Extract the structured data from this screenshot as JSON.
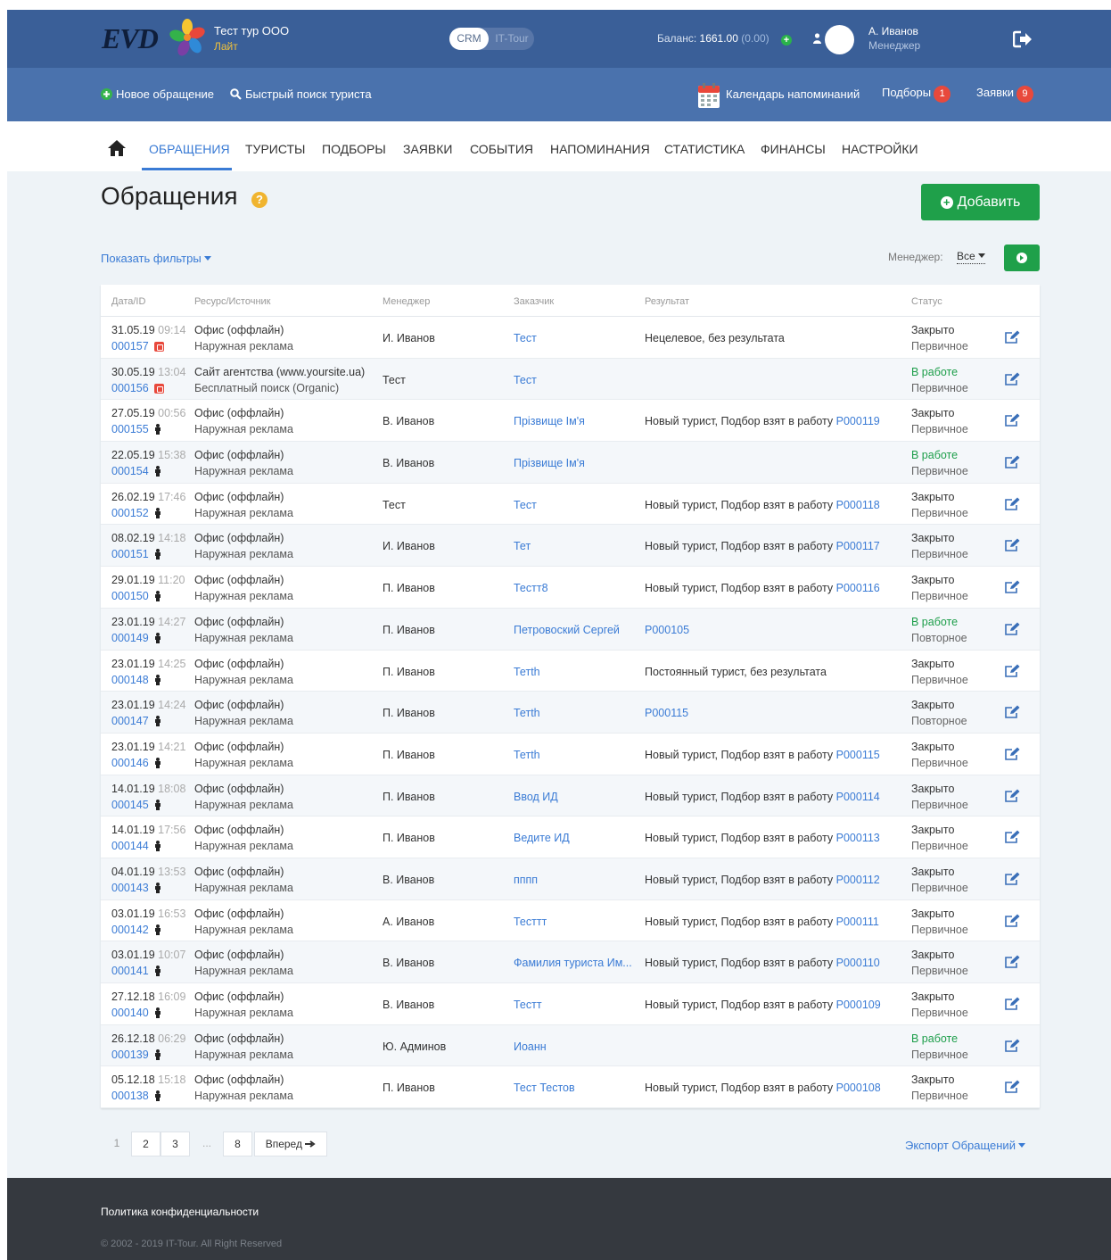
{
  "header": {
    "logo_text": "EVD",
    "company_name": "Тест тур ООО",
    "plan": "Лайт",
    "switch_on": "CRM",
    "switch_off": "IT-Tour",
    "balance_label": "Баланс:",
    "balance_value": "1661.00",
    "balance_extra": "(0.00)",
    "user_name": "А. Иванов",
    "user_role": "Менеджер"
  },
  "subbar": {
    "new_request": "Новое обращение",
    "quick_search": "Быстрый поиск туриста",
    "calendar": "Календарь напоминаний",
    "selections": "Подборы",
    "selections_count": "1",
    "orders": "Заявки",
    "orders_count": "9"
  },
  "nav": {
    "items": [
      "ОБРАЩЕНИЯ",
      "ТУРИСТЫ",
      "ПОДБОРЫ",
      "ЗАЯВКИ",
      "СОБЫТИЯ",
      "НАПОМИНАНИЯ",
      "СТАТИСТИКА",
      "ФИНАНСЫ",
      "НАСТРОЙКИ"
    ]
  },
  "page": {
    "title": "Обращения",
    "help": "?",
    "add_button": "Добавить",
    "show_filters": "Показать фильтры",
    "manager_label": "Менеджер:",
    "manager_value": "Все"
  },
  "table": {
    "headers": [
      "Дата/ID",
      "Ресурс/Источник",
      "Менеджер",
      "Заказчик",
      "Результат",
      "Статус"
    ],
    "rows": [
      {
        "date": "31.05.19",
        "time": "09:14",
        "id": "000157",
        "src": "phone",
        "res1": "Офис (оффлайн)",
        "res2": "Наружная реклама",
        "mgr": "И. Иванов",
        "cust": "Тест",
        "result": "Нецелевое, без результата",
        "rlink": "",
        "st1": "Закрыто",
        "st2": "Первичное"
      },
      {
        "date": "30.05.19",
        "time": "13:04",
        "id": "000156",
        "src": "phone",
        "res1": "Сайт агентства (www.yoursite.ua)",
        "res2": "Бесплатный поиск (Organic)",
        "mgr": "Тест",
        "cust": "Тест",
        "result": "",
        "rlink": "",
        "st1": "",
        "st2": "Первичное"
      },
      {
        "date": "27.05.19",
        "time": "00:56",
        "id": "000155",
        "src": "person",
        "res1": "Офис (оффлайн)",
        "res2": "Наружная реклама",
        "mgr": "В. Иванов",
        "cust": "Прізвище Ім'я",
        "result": "Новый турист, Подбор взят в работу ",
        "rlink": "P000119",
        "st1": "Закрыто",
        "st2": "Первичное"
      },
      {
        "date": "22.05.19",
        "time": "15:38",
        "id": "000154",
        "src": "person",
        "res1": "Офис (оффлайн)",
        "res2": "Наружная реклама",
        "mgr": "В. Иванов",
        "cust": "Прізвище Ім'я",
        "result": "",
        "rlink": "",
        "st1": "",
        "st2": "Первичное"
      },
      {
        "date": "26.02.19",
        "time": "17:46",
        "id": "000152",
        "src": "person",
        "res1": "Офис (оффлайн)",
        "res2": "Наружная реклама",
        "mgr": "Тест",
        "cust": "Тест",
        "result": "Новый турист, Подбор взят в работу ",
        "rlink": "P000118",
        "st1": "Закрыто",
        "st2": "Первичное"
      },
      {
        "date": "08.02.19",
        "time": "14:18",
        "id": "000151",
        "src": "person",
        "res1": "Офис (оффлайн)",
        "res2": "Наружная реклама",
        "mgr": "И. Иванов",
        "cust": "Тет",
        "result": "Новый турист, Подбор взят в работу ",
        "rlink": "P000117",
        "st1": "Закрыто",
        "st2": "Первичное"
      },
      {
        "date": "29.01.19",
        "time": "11:20",
        "id": "000150",
        "src": "person",
        "res1": "Офис (оффлайн)",
        "res2": "Наружная реклама",
        "mgr": "П. Иванов",
        "cust": "Тестт8",
        "result": "Новый турист, Подбор взят в работу ",
        "rlink": "P000116",
        "st1": "Закрыто",
        "st2": "Первичное"
      },
      {
        "date": "23.01.19",
        "time": "14:27",
        "id": "000149",
        "src": "person",
        "res1": "Офис (оффлайн)",
        "res2": "Наружная реклама",
        "mgr": "П. Иванов",
        "cust": "Петровоский Сергей",
        "result": "",
        "rlink": "P000105",
        "st1": "",
        "st2": "Повторное"
      },
      {
        "date": "23.01.19",
        "time": "14:25",
        "id": "000148",
        "src": "person",
        "res1": "Офис (оффлайн)",
        "res2": "Наружная реклама",
        "mgr": "П. Иванов",
        "cust": "Тетth",
        "result": "Постоянный турист, без результата",
        "rlink": "",
        "st1": "Закрыто",
        "st2": "Первичное"
      },
      {
        "date": "23.01.19",
        "time": "14:24",
        "id": "000147",
        "src": "person",
        "res1": "Офис (оффлайн)",
        "res2": "Наружная реклама",
        "mgr": "П. Иванов",
        "cust": "Тетth",
        "result": "",
        "rlink": "P000115",
        "st1": "Закрыто",
        "st2": "Повторное"
      },
      {
        "date": "23.01.19",
        "time": "14:21",
        "id": "000146",
        "src": "person",
        "res1": "Офис (оффлайн)",
        "res2": "Наружная реклама",
        "mgr": "П. Иванов",
        "cust": "Тетth",
        "result": "Новый турист, Подбор взят в работу ",
        "rlink": "P000115",
        "st1": "Закрыто",
        "st2": "Первичное"
      },
      {
        "date": "14.01.19",
        "time": "18:08",
        "id": "000145",
        "src": "person",
        "res1": "Офис (оффлайн)",
        "res2": "Наружная реклама",
        "mgr": "П. Иванов",
        "cust": "Ввод ИД",
        "result": "Новый турист, Подбор взят в работу ",
        "rlink": "P000114",
        "st1": "Закрыто",
        "st2": "Первичное"
      },
      {
        "date": "14.01.19",
        "time": "17:56",
        "id": "000144",
        "src": "person",
        "res1": "Офис (оффлайн)",
        "res2": "Наружная реклама",
        "mgr": "П. Иванов",
        "cust": "Ведите ИД",
        "result": "Новый турист, Подбор взят в работу ",
        "rlink": "P000113",
        "st1": "Закрыто",
        "st2": "Первичное"
      },
      {
        "date": "04.01.19",
        "time": "13:53",
        "id": "000143",
        "src": "person",
        "res1": "Офис (оффлайн)",
        "res2": "Наружная реклама",
        "mgr": "В. Иванов",
        "cust": "пппп",
        "result": "Новый турист, Подбор взят в работу ",
        "rlink": "P000112",
        "st1": "Закрыто",
        "st2": "Первичное"
      },
      {
        "date": "03.01.19",
        "time": "16:53",
        "id": "000142",
        "src": "person",
        "res1": "Офис (оффлайн)",
        "res2": "Наружная реклама",
        "mgr": "А. Иванов",
        "cust": "Тесттт",
        "result": "Новый турист, Подбор взят в работу ",
        "rlink": "P000111",
        "st1": "Закрыто",
        "st2": "Первичное"
      },
      {
        "date": "03.01.19",
        "time": "10:07",
        "id": "000141",
        "src": "person",
        "res1": "Офис (оффлайн)",
        "res2": "Наружная реклама",
        "mgr": "В. Иванов",
        "cust": "Фамилия туриста Им...",
        "result": "Новый турист, Подбор взят в работу ",
        "rlink": "P000110",
        "st1": "Закрыто",
        "st2": "Первичное"
      },
      {
        "date": "27.12.18",
        "time": "16:09",
        "id": "000140",
        "src": "person",
        "res1": "Офис (оффлайн)",
        "res2": "Наружная реклама",
        "mgr": "В. Иванов",
        "cust": "Тестт",
        "result": "Новый турист, Подбор взят в работу ",
        "rlink": "P000109",
        "st1": "Закрыто",
        "st2": "Первичное"
      },
      {
        "date": "26.12.18",
        "time": "06:29",
        "id": "000139",
        "src": "person",
        "res1": "Офис (оффлайн)",
        "res2": "Наружная реклама",
        "mgr": "Ю. Админов",
        "cust": "Иоанн",
        "result": "",
        "rlink": "",
        "st1": "",
        "st2": "Первичное"
      },
      {
        "date": "05.12.18",
        "time": "15:18",
        "id": "000138",
        "src": "person",
        "res1": "Офис (оффлайн)",
        "res2": "Наружная реклама",
        "mgr": "П. Иванов",
        "cust": "Тест Тестов",
        "result": "Новый турист, Подбор взят в работу ",
        "rlink": "P000108",
        "st1": "Закрыто",
        "st2": "Первичное"
      }
    ],
    "work_status": "В работе"
  },
  "pagination": {
    "pages": [
      "1",
      "2",
      "3",
      "...",
      "8"
    ],
    "next": "Вперед"
  },
  "export_link": "Экспорт Обращений",
  "footer": {
    "policy": "Политика конфиденциальности",
    "copyright": "© 2002 - 2019 IT-Tour. All Right Reserved"
  },
  "colors": {
    "topbar": "#3a5f98",
    "subbar": "#4a72ad",
    "accent": "#3a7bd5",
    "green": "#1fa04a",
    "badge": "#e8493c"
  }
}
